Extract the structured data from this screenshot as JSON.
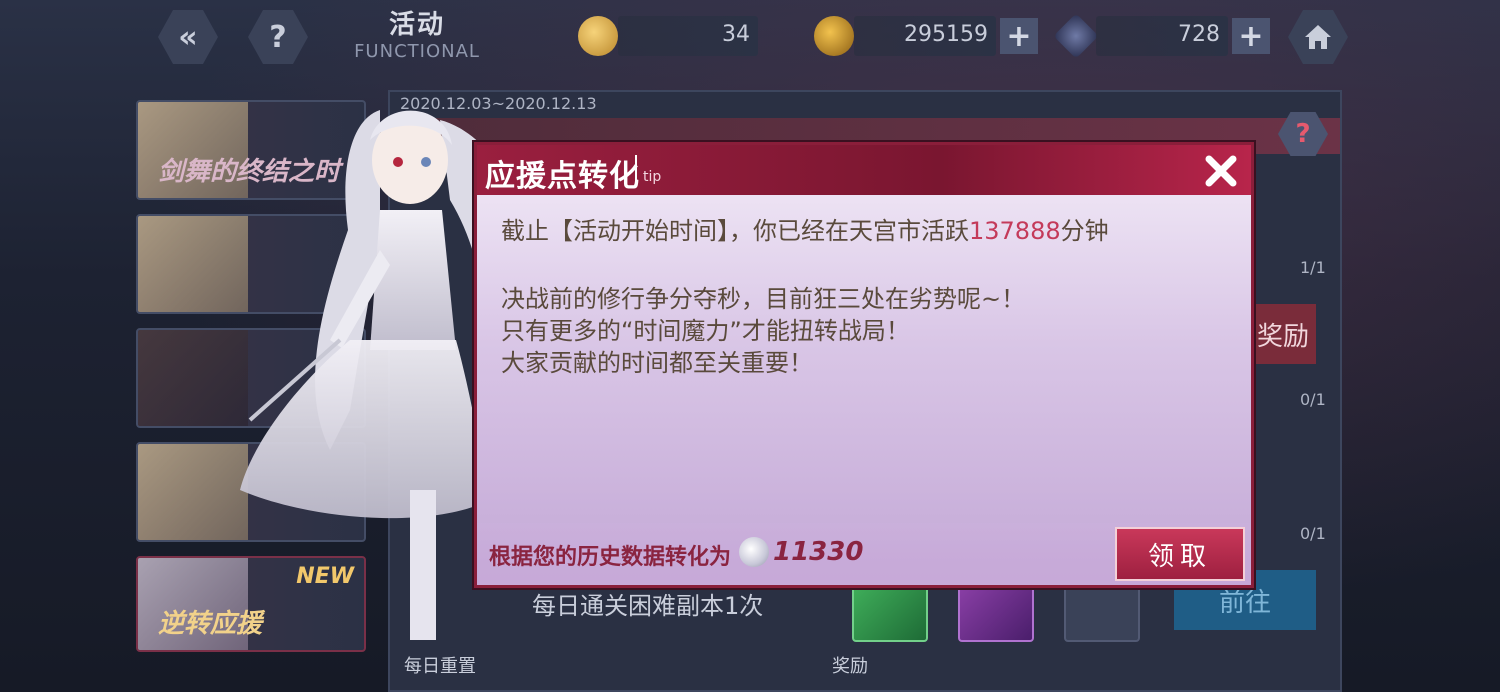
{
  "header": {
    "title_cn": "活动",
    "title_en": "FUNCTIONAL",
    "resources": [
      {
        "name": "coin",
        "value": "34"
      },
      {
        "name": "gold",
        "value": "295159"
      },
      {
        "name": "crystal",
        "value": "728"
      }
    ],
    "back_icon": "back-arrow-icon",
    "help_icon": "question-icon",
    "home_icon": "home-icon"
  },
  "left_list": {
    "items": [
      {
        "label": "剑舞的终结之时",
        "new": ""
      },
      {
        "label": "",
        "new": ""
      },
      {
        "label": "",
        "new": ""
      },
      {
        "label": "",
        "new": ""
      },
      {
        "label": "逆转应援",
        "new": "NEW"
      }
    ]
  },
  "panel": {
    "date_range": "2020.12.03~2020.12.13",
    "counts": [
      "1/1",
      "0/1",
      "0/1"
    ],
    "reward_button": "奖励",
    "task": "每日通关困难副本1次",
    "daily": "每日重置",
    "reward_label": "奖励",
    "goto_button": "前往"
  },
  "dialog": {
    "title": "应援点转化",
    "tip": "tip",
    "line1_pre": "截止【活动开始时间】，你已经在天宫市活跃",
    "line1_minutes": "137888",
    "line1_post": "分钟",
    "line2": "决战前的修行争分夺秒，目前狂三处在劣势呢~！",
    "line3": "只有更多的“时间魔力”才能扭转战局！",
    "line4": "大家贡献的时间都至关重要！",
    "footer_text": "根据您的历史数据转化为",
    "footer_value": "11330",
    "claim_button": "领取"
  },
  "colors": {
    "dialog_header": "#9a1f3f",
    "highlight": "#c43a5a",
    "body_text": "#5a4a3c"
  }
}
